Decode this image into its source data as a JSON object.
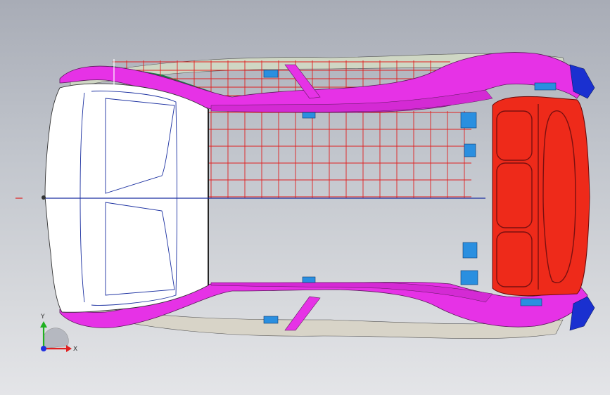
{
  "viewport": {
    "background_top": "#a8acb6",
    "background_bottom": "#e4e5e8"
  },
  "model": {
    "body_color": "#e632e6",
    "floor_color": "#ffffff",
    "rear_panel_color": "#ee2a1a",
    "glass_color": "#1f7a4a",
    "bracket_color": "#2a8fe0",
    "grid_color": "#e02020",
    "centerline_color": "#1a2fa0",
    "triad_x_color": "#e02020",
    "triad_y_color": "#20b020",
    "triad_z_color": "#2030e0"
  },
  "triad": {
    "x_label": "X",
    "y_label": "Y"
  }
}
